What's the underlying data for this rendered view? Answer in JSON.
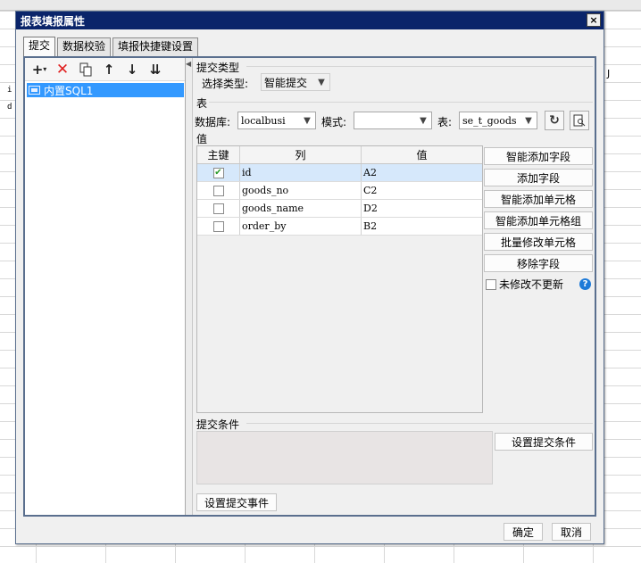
{
  "background": {
    "column_letter": "J",
    "fragments": [
      "i",
      "d"
    ]
  },
  "dialog": {
    "title": "报表填报属性",
    "close_label": "×",
    "tabs": [
      {
        "label": "提交",
        "active": true
      },
      {
        "label": "数据校验",
        "active": false
      },
      {
        "label": "填报快捷键设置",
        "active": false
      }
    ],
    "ok_label": "确定",
    "cancel_label": "取消"
  },
  "left_panel": {
    "toolbar_icons": [
      "add-icon",
      "delete-icon",
      "copy-icon",
      "move-up-icon",
      "move-down-icon",
      "move-bottom-icon"
    ],
    "tree_items": [
      {
        "label": "内置SQL1",
        "selected": true
      }
    ]
  },
  "submit_type": {
    "section_title": "提交类型",
    "select_label": "选择类型:",
    "selected": "智能提交"
  },
  "table_section": {
    "section_title": "表",
    "db_label": "数据库:",
    "db_value": "localbusi",
    "schema_label": "模式:",
    "schema_value": "",
    "table_label": "表:",
    "table_value": "se_t_goods",
    "refresh_icon": "refresh-icon",
    "preview_icon": "search-document-icon"
  },
  "value_section": {
    "section_title": "值",
    "columns": {
      "key": "主键",
      "column": "列",
      "value": "值"
    },
    "rows": [
      {
        "key": true,
        "column": "id",
        "value": "A2",
        "selected": true
      },
      {
        "key": false,
        "column": "goods_no",
        "value": "C2",
        "selected": false
      },
      {
        "key": false,
        "column": "goods_name",
        "value": "D2",
        "selected": false
      },
      {
        "key": false,
        "column": "order_by",
        "value": "B2",
        "selected": false
      }
    ],
    "buttons": [
      "智能添加字段",
      "添加字段",
      "智能添加单元格",
      "智能添加单元格组",
      "批量修改单元格",
      "移除字段"
    ],
    "no_update_label": "未修改不更新",
    "no_update_checked": false,
    "help_label": "?"
  },
  "condition_section": {
    "section_title": "提交条件",
    "set_condition_label": "设置提交条件"
  },
  "event_button_label": "设置提交事件"
}
